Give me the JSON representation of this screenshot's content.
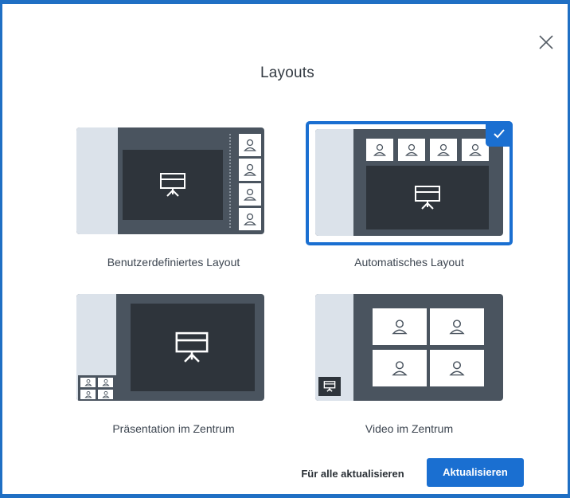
{
  "dialog": {
    "title": "Layouts",
    "close_icon": "close-icon"
  },
  "layouts": [
    {
      "label": "Benutzerdefiniertes Layout",
      "selected": false
    },
    {
      "label": "Automatisches Layout",
      "selected": true
    },
    {
      "label": "Präsentation im Zentrum",
      "selected": false
    },
    {
      "label": "Video im Zentrum",
      "selected": false
    }
  ],
  "footer": {
    "secondary_label": "Für alle aktualisieren",
    "primary_label": "Aktualisieren"
  },
  "colors": {
    "accent": "#1a6fd1",
    "card_bg": "#4a545f",
    "screen_bg": "#2e343b",
    "strip_bg": "#dbe2ea"
  }
}
